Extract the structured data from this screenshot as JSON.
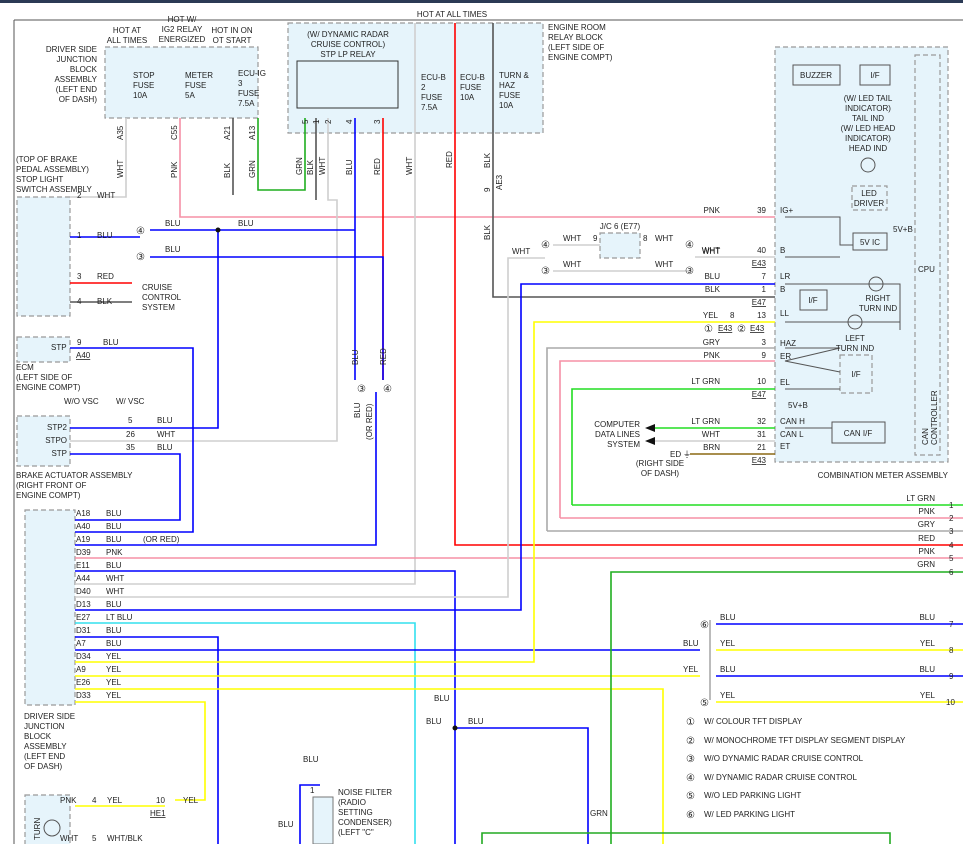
{
  "colors": {
    "PNK": "#f590a6",
    "BLU": "#0000ff",
    "RED": "#ff0000",
    "GRN": "#1fae1f",
    "LTGRN": "#22dd22",
    "YEL": "#ffff00",
    "WHT": "#cfcfcf",
    "BLK": "#555555",
    "GRY": "#aaaaaa",
    "LTBLU": "#33e0ee",
    "BRN": "#8b6914",
    "box_fill": "#e6f4fb"
  },
  "top": {
    "driver_jb": [
      "DRIVER SIDE",
      "JUNCTION",
      "BLOCK",
      "ASSEMBLY",
      "(LEFT END",
      "OF DASH)"
    ],
    "hot1": [
      "HOT AT",
      "ALL TIMES"
    ],
    "hot2": [
      "HOT W/",
      "IG2 RELAY",
      "ENERGIZED"
    ],
    "hot3": [
      "HOT IN ON",
      "OT START"
    ],
    "fuse1": [
      "STOP",
      "FUSE",
      "10A"
    ],
    "fuse2": [
      "METER",
      "FUSE",
      "5A"
    ],
    "fuse3": [
      "ECU-IG",
      "3",
      "FUSE",
      "7.5A"
    ],
    "pins": [
      "A35",
      "C55",
      "A21",
      "A13"
    ],
    "wires": [
      "WHT",
      "PNK",
      "BLK",
      "GRN"
    ]
  },
  "relay_block": {
    "hot": "HOT AT ALL TIMES",
    "label": [
      "ENGINE ROOM",
      "RELAY BLOCK",
      "(LEFT SIDE OF",
      "ENGINE COMPT)"
    ],
    "relay": [
      "(W/ DYNAMIC RADAR",
      "CRUISE CONTROL)",
      "STP LP RELAY"
    ],
    "relay_pins": [
      "5",
      "1",
      "2",
      "4",
      "3"
    ],
    "relay_wires": [
      "GRN",
      "BLK",
      "WHT",
      "BLU",
      "RED"
    ],
    "fuse1": [
      "ECU-B",
      "2",
      "FUSE",
      "7.5A"
    ],
    "fuse2": [
      "ECU-B",
      "FUSE",
      "10A"
    ],
    "fuse3": [
      "TURN &",
      "HAZ",
      "FUSE",
      "10A"
    ],
    "fuse_wires": [
      "WHT",
      "RED",
      "BLK"
    ],
    "ae3_pin": "9",
    "ae3": "AE3",
    "blk2": "BLK"
  },
  "stop_switch": {
    "label": [
      "(TOP OF BRAKE",
      "PEDAL ASSEMBLY)",
      "STOP LIGHT",
      "SWITCH ASSEMBLY"
    ],
    "pins": [
      "2",
      "1",
      "3",
      "4"
    ],
    "wires": [
      "WHT",
      "BLU",
      "RED",
      "BLK"
    ],
    "cruise": [
      "CRUISE",
      "CONTROL",
      "SYSTEM"
    ],
    "c4": "④",
    "c3": "③",
    "blu_a": "BLU",
    "blu_b": "BLU",
    "blu_c": "BLU"
  },
  "ecm": {
    "pin_name": "STP",
    "pin": "9",
    "wire": "BLU",
    "conn": "A40",
    "label": [
      "ECM",
      "(LEFT SIDE OF",
      "ENGINE COMPT)"
    ]
  },
  "mid": {
    "c3": "③",
    "c4": "④",
    "blu": "BLU",
    "red": "RED",
    "blu2": "BLU",
    "or_red": "(OR RED)"
  },
  "brake_actuator": {
    "wo_vsc": "W/O VSC",
    "w_vsc": "W/ VSC",
    "pin_names": [
      "STP2",
      "STPO",
      "STP"
    ],
    "pins": [
      "5",
      "26",
      "35"
    ],
    "wires": [
      "BLU",
      "WHT",
      "BLU"
    ],
    "label": [
      "BRAKE ACTUATOR ASSEMBLY",
      "(RIGHT FRONT OF",
      "ENGINE COMPT)"
    ]
  },
  "bottom_jb": {
    "rows": [
      {
        "pin": "A18",
        "wire": "BLU"
      },
      {
        "pin": "A40",
        "wire": "BLU"
      },
      {
        "pin": "A19",
        "wire": "BLU"
      },
      {
        "pin": "D39",
        "wire": "PNK"
      },
      {
        "pin": "E11",
        "wire": "BLU"
      },
      {
        "pin": "A44",
        "wire": "WHT"
      },
      {
        "pin": "D40",
        "wire": "WHT"
      },
      {
        "pin": "D13",
        "wire": "BLU"
      },
      {
        "pin": "E27",
        "wire": "LT BLU"
      },
      {
        "pin": "D31",
        "wire": "BLU"
      },
      {
        "pin": "A7",
        "wire": "BLU"
      },
      {
        "pin": "D34",
        "wire": "YEL"
      },
      {
        "pin": "A9",
        "wire": "YEL"
      },
      {
        "pin": "E26",
        "wire": "YEL"
      },
      {
        "pin": "D33",
        "wire": "YEL"
      }
    ],
    "or_red": "(OR RED)",
    "label": [
      "DRIVER SIDE",
      "JUNCTION",
      "BLOCK",
      "ASSEMBLY",
      "(LEFT END",
      "OF DASH)"
    ]
  },
  "jc6": {
    "label": "J/C 6 (E77)",
    "pin_l": "9",
    "pin_r": "8",
    "w1": "WHT",
    "w2": "WHT",
    "w3": "WHT",
    "w4": "WHT",
    "w5": "WHT",
    "w6": "WHT",
    "c4l": "④",
    "c3l": "③",
    "c4r": "④",
    "c3r": "③"
  },
  "meter": {
    "title": "COMBINATION METER ASSEMBLY",
    "pins": [
      {
        "wire": "PNK",
        "num": "39",
        "name": "IG+"
      },
      {
        "wire": "WHT",
        "num": "40",
        "name": "B",
        "conn": "E43"
      },
      {
        "wire": "BLU",
        "num": "7",
        "name": "LR"
      },
      {
        "wire": "BLK",
        "num": "1",
        "name": "B",
        "conn": "E47"
      },
      {
        "wire": "YEL",
        "alt": "8",
        "num": "13",
        "name": "LL"
      },
      {
        "wire": "GRY",
        "num": "3",
        "name": "HAZ"
      },
      {
        "wire": "PNK",
        "num": "9",
        "name": "ER"
      },
      {
        "wire": "LT GRN",
        "num": "10",
        "name": "EL",
        "conn": "E47"
      },
      {
        "wire": "LT GRN",
        "num": "32",
        "name": "CAN H"
      },
      {
        "wire": "WHT",
        "num": "31",
        "name": "CAN L"
      },
      {
        "wire": "BRN",
        "num": "21",
        "name": "ET",
        "conn": "E43"
      }
    ],
    "conn_variants": [
      "①",
      "E43",
      "②",
      "E43"
    ],
    "buzzer": "BUZZER",
    "if": "I/F",
    "led_text": [
      "(W/ LED TAIL",
      "INDICATOR)",
      "TAIL IND",
      "(W/ LED HEAD",
      "INDICATOR)",
      "HEAD IND"
    ],
    "led_driver": [
      "LED",
      "DRIVER"
    ],
    "five_v_ic": "5V IC",
    "five_vb": "5V+B",
    "cpu": "CPU",
    "right_turn": [
      "RIGHT",
      "TURN IND"
    ],
    "left_turn": [
      "LEFT",
      "TURN IND"
    ],
    "if2": "I/F",
    "if3": "I/F",
    "five_vb2": "5V+B",
    "can_if": "CAN I/F",
    "can_ctrl": [
      "CAN",
      "CONTROLLER"
    ]
  },
  "data_lines": {
    "label": [
      "COMPUTER",
      "DATA LINES",
      "SYSTEM"
    ],
    "ed": "ED",
    "ed_loc": [
      "(RIGHT SIDE",
      "OF DASH)"
    ]
  },
  "right_outputs": [
    {
      "num": "1",
      "wire": "LT GRN"
    },
    {
      "num": "2",
      "wire": "PNK"
    },
    {
      "num": "3",
      "wire": "GRY"
    },
    {
      "num": "4",
      "wire": "RED"
    },
    {
      "num": "5",
      "wire": "PNK"
    },
    {
      "num": "6",
      "wire": "GRN"
    },
    {
      "num": "7",
      "wire": "BLU"
    },
    {
      "num": "8",
      "wire": "YEL"
    },
    {
      "num": "9",
      "wire": "BLU"
    },
    {
      "num": "10",
      "wire": "YEL"
    }
  ],
  "right_conn": {
    "c6": "⑥",
    "c5": "⑤",
    "in": [
      "BLU",
      "YEL",
      "BLU",
      "YEL"
    ],
    "left": [
      "BLU",
      "YEL"
    ]
  },
  "legend": [
    {
      "mark": "①",
      "text": "W/ COLOUR TFT DISPLAY"
    },
    {
      "mark": "②",
      "text": "W/ MONOCHROME TFT DISPLAY SEGMENT DISPLAY"
    },
    {
      "mark": "③",
      "text": "W/O DYNAMIC RADAR CRUISE CONTROL"
    },
    {
      "mark": "④",
      "text": "W/ DYNAMIC RADAR CRUISE CONTROL"
    },
    {
      "mark": "⑤",
      "text": "W/O LED PARKING LIGHT"
    },
    {
      "mark": "⑥",
      "text": "W/ LED PARKING LIGHT"
    }
  ],
  "bottom": {
    "blu1": "BLU",
    "blu2": "BLU",
    "blu3": "BLU",
    "blu4": "BLU",
    "blu5": "BLU",
    "pin1": "1",
    "grn": "GRN",
    "noise": [
      "NOISE FILTER",
      "(RADIO",
      "SETTING",
      "CONDENSER)",
      "(LEFT \"C\""
    ],
    "turn": "TURN",
    "pnk": "PNK",
    "p4": "4",
    "yel": "YEL",
    "p10": "10",
    "yel2": "YEL",
    "he1": "HE1",
    "wht": "WHT",
    "p5": "5",
    "whtblk": "WHT/BLK"
  }
}
